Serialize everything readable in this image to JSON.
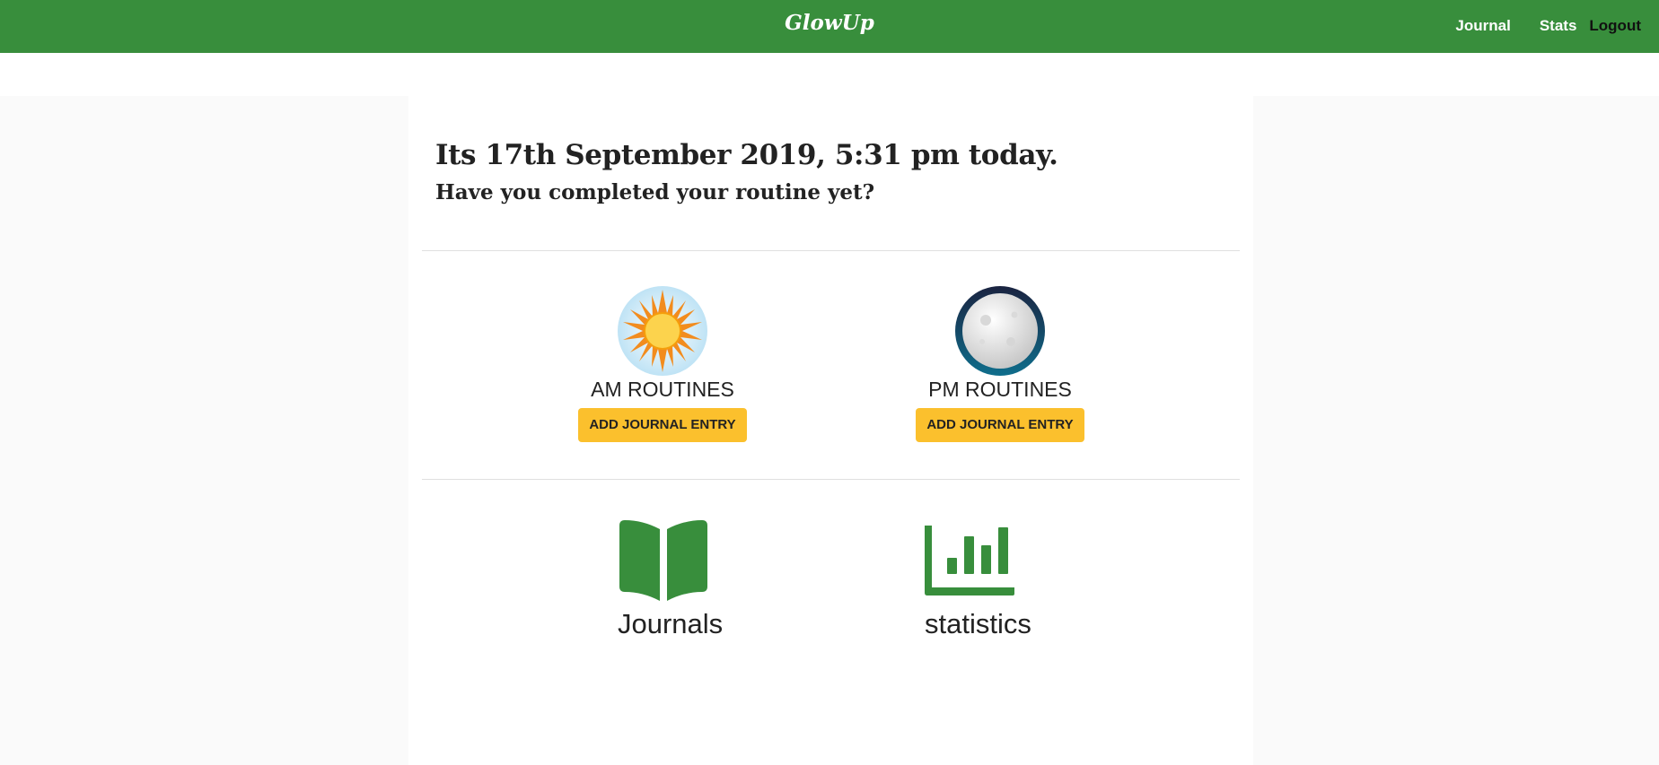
{
  "navbar": {
    "brand": "GlowUp",
    "links": [
      {
        "label": "Journal"
      },
      {
        "label": "Stats"
      },
      {
        "label": "Logout"
      }
    ],
    "color": "#388e3c"
  },
  "greeting": {
    "headline": "Its 17th September 2019, 5:31 pm today.",
    "question": "Have you completed your routine yet?"
  },
  "routines": [
    {
      "icon": "sun-icon",
      "title": "AM ROUTINES",
      "button_label": "ADD JOURNAL ENTRY"
    },
    {
      "icon": "moon-icon",
      "title": "PM ROUTINES",
      "button_label": "ADD JOURNAL ENTRY"
    }
  ],
  "tiles": [
    {
      "icon": "book-icon",
      "label": "Journals"
    },
    {
      "icon": "bar-chart-icon",
      "label": "statistics"
    }
  ],
  "colors": {
    "accent_button": "#fbc02d",
    "icon_green": "#388e3c"
  }
}
